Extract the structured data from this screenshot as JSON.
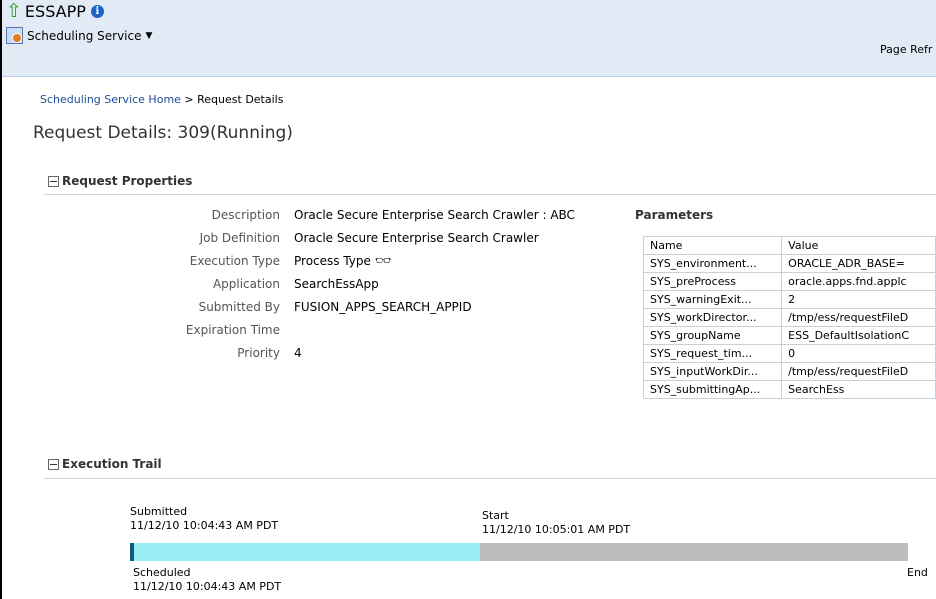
{
  "app": {
    "title": "ESSAPP",
    "info_icon": "i"
  },
  "menu": {
    "service_label": "Scheduling Service"
  },
  "header": {
    "page_refresh": "Page Refr"
  },
  "breadcrumb": {
    "home": "Scheduling Service Home",
    "separator": ">",
    "current": "Request Details"
  },
  "page": {
    "title": "Request Details: 309(Running)"
  },
  "request_properties": {
    "heading": "Request Properties",
    "rows": [
      {
        "label": "Description",
        "value": "Oracle Secure Enterprise Search Crawler : ABC"
      },
      {
        "label": "Job Definition",
        "value": "Oracle Secure Enterprise Search Crawler"
      },
      {
        "label": "Execution Type",
        "value": "Process Type"
      },
      {
        "label": "Application",
        "value": "SearchEssApp"
      },
      {
        "label": "Submitted By",
        "value": "FUSION_APPS_SEARCH_APPID"
      },
      {
        "label": "Expiration Time",
        "value": ""
      },
      {
        "label": "Priority",
        "value": "4"
      }
    ]
  },
  "parameters": {
    "heading": "Parameters",
    "columns": [
      "Name",
      "Value"
    ],
    "rows": [
      [
        "SYS_environment...",
        "ORACLE_ADR_BASE="
      ],
      [
        "SYS_preProcess",
        "oracle.apps.fnd.applc"
      ],
      [
        "SYS_warningExit...",
        "2"
      ],
      [
        "SYS_workDirector...",
        "/tmp/ess/requestFileD"
      ],
      [
        "SYS_groupName",
        "ESS_DefaultIsolationC"
      ],
      [
        "SYS_request_tim...",
        "0"
      ],
      [
        "SYS_inputWorkDir...",
        "/tmp/ess/requestFileD"
      ],
      [
        "SYS_submittingAp...",
        "SearchEss"
      ]
    ]
  },
  "execution_trail": {
    "heading": "Execution Trail",
    "submitted_label": "Submitted",
    "submitted_time": "11/12/10 10:04:43 AM PDT",
    "start_label": "Start",
    "start_time": "11/12/10 10:05:01 AM PDT",
    "scheduled_label": "Scheduled",
    "scheduled_time": "11/12/10 10:04:43 AM PDT",
    "end_label": "End",
    "colors": {
      "completed": "#99eef6",
      "pending": "#bdbdbd",
      "marker": "#0f5a82"
    }
  },
  "icons": {
    "app": "green-up-arrow-icon",
    "info": "info-icon",
    "service": "scheduling-service-icon",
    "dropdown": "caret-down-icon",
    "execution_type": "glasses-icon",
    "collapse": "collapse-minus-icon"
  }
}
